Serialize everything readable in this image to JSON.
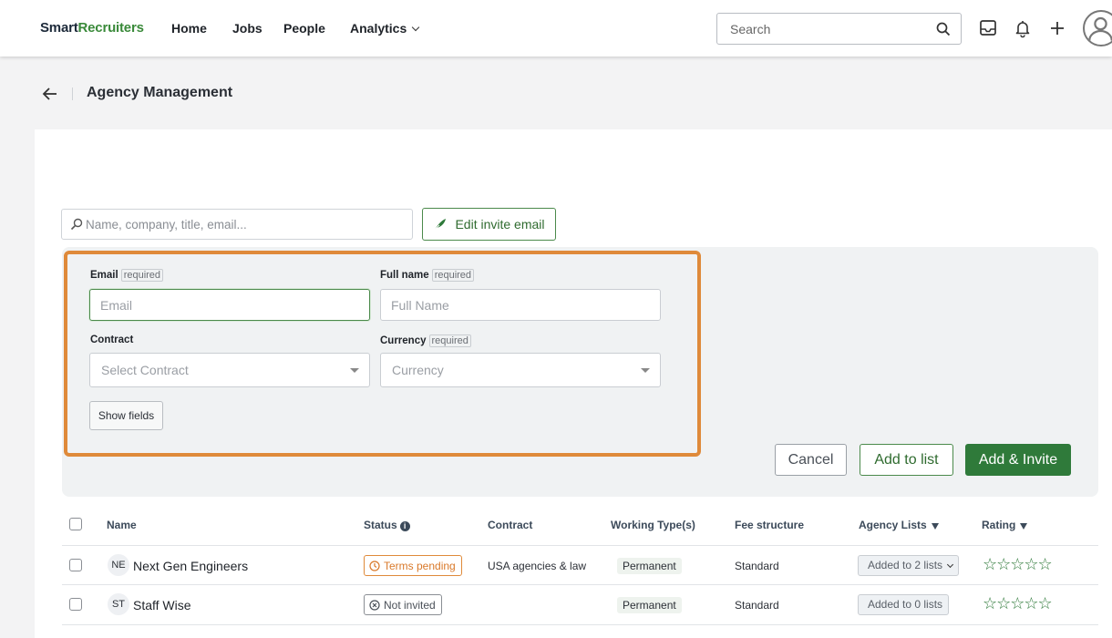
{
  "brand": {
    "part1": "Smart",
    "part2": "Recruiters"
  },
  "nav": {
    "home": "Home",
    "jobs": "Jobs",
    "people": "People",
    "analytics": "Analytics"
  },
  "search": {
    "placeholder": "Search"
  },
  "header": {
    "title": "Agency Management"
  },
  "agency_search": {
    "placeholder": "Name, company, title, email..."
  },
  "edit_invite_label": "Edit invite email",
  "form": {
    "email_label": "Email",
    "email_placeholder": "Email",
    "fullname_label": "Full name",
    "fullname_placeholder": "Full Name",
    "required_tag": "required",
    "contract_label": "Contract",
    "contract_placeholder": "Select Contract",
    "currency_label": "Currency",
    "currency_placeholder": "Currency",
    "show_fields": "Show fields"
  },
  "actions": {
    "cancel": "Cancel",
    "add_to_list": "Add to list",
    "add_invite": "Add & Invite"
  },
  "table": {
    "headers": {
      "name": "Name",
      "status": "Status",
      "contract": "Contract",
      "working_types": "Working Type(s)",
      "fee_structure": "Fee structure",
      "agency_lists": "Agency Lists",
      "rating": "Rating"
    },
    "rows": [
      {
        "initials": "NE",
        "name": "Next Gen Engineers",
        "status": "Terms pending",
        "contract": "USA agencies & law",
        "working_type": "Permanent",
        "fee": "Standard",
        "lists": "Added to 2 lists",
        "stars": "☆☆☆☆☆"
      },
      {
        "initials": "ST",
        "name": "Staff Wise",
        "status": "Not invited",
        "contract": "",
        "working_type": "Permanent",
        "fee": "Standard",
        "lists": "Added to 0 lists",
        "stars": "☆☆☆☆☆"
      }
    ]
  },
  "colors": {
    "brand_green": "#3a8a3a",
    "primary_button": "#2f7a3a",
    "highlight_orange": "#df8a3a"
  }
}
